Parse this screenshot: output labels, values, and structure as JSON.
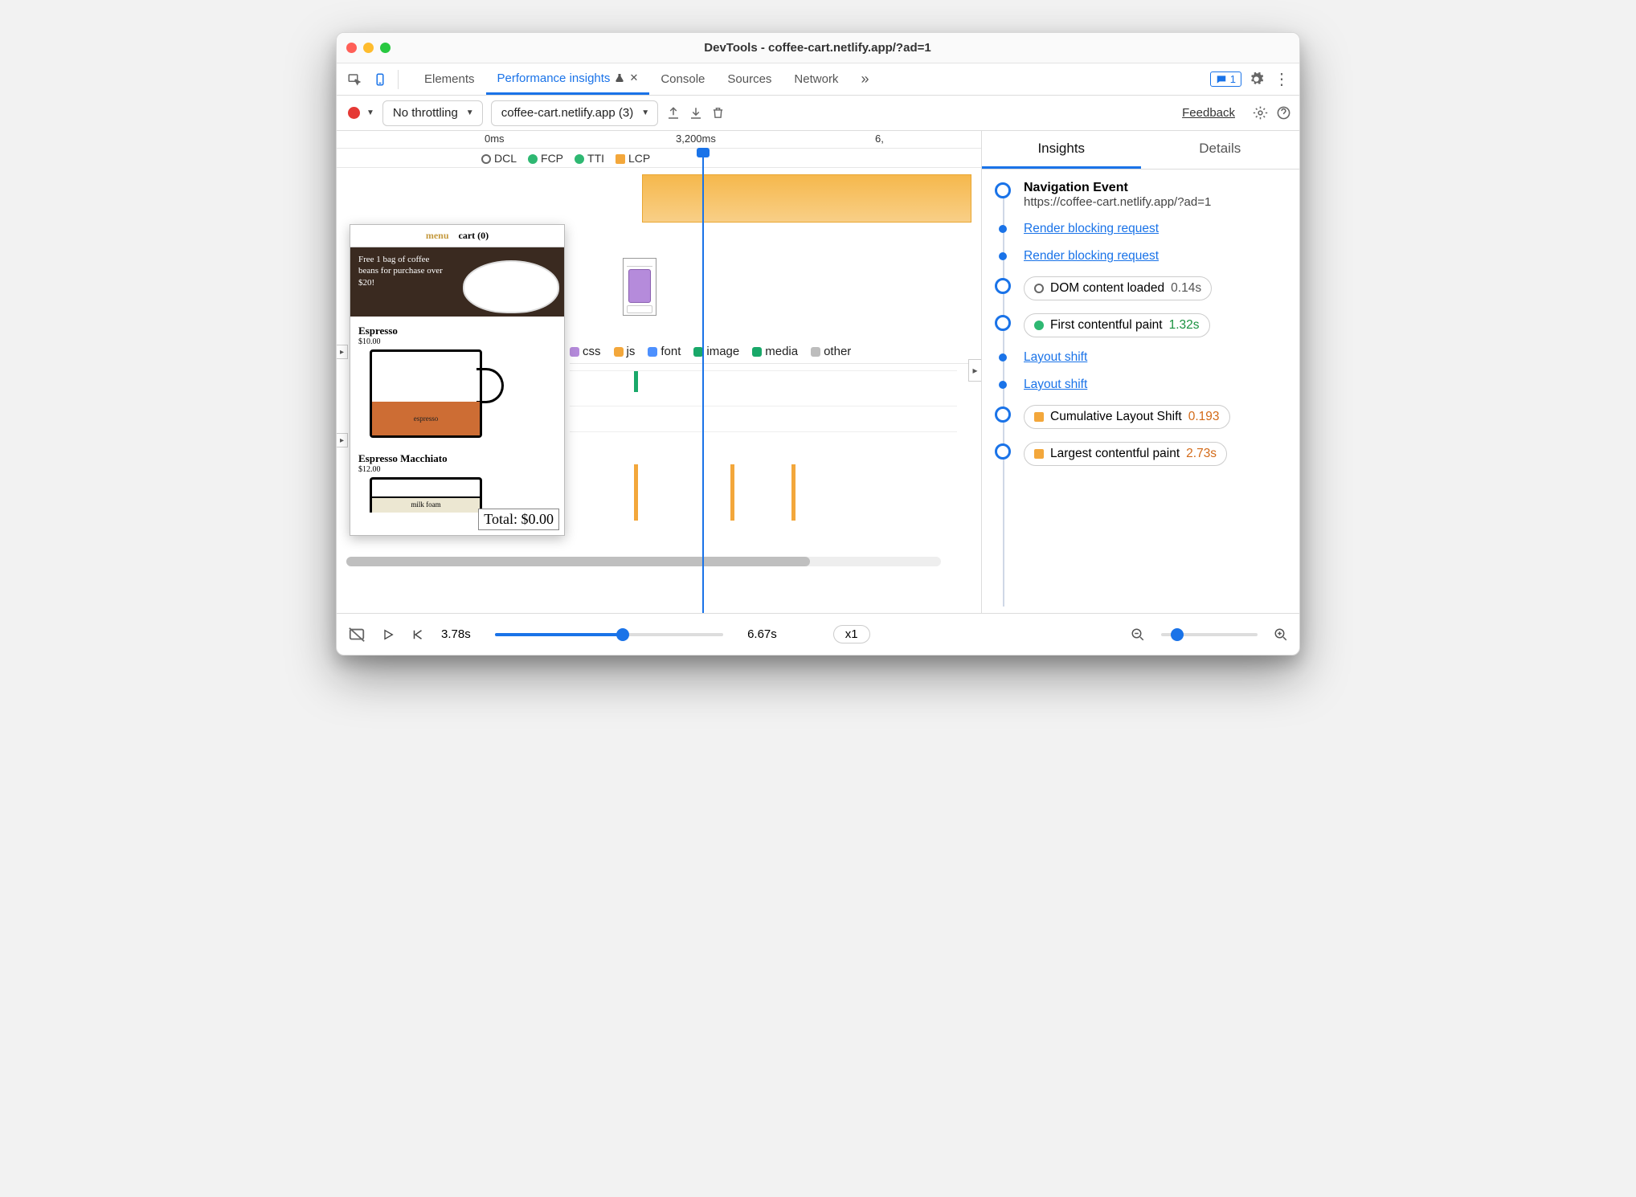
{
  "window": {
    "title": "DevTools - coffee-cart.netlify.app/?ad=1"
  },
  "tabs": {
    "elements": "Elements",
    "perf": "Performance insights",
    "console": "Console",
    "sources": "Sources",
    "network": "Network",
    "msg_count": "1"
  },
  "toolbar": {
    "throttling": "No throttling",
    "session": "coffee-cart.netlify.app (3)",
    "feedback": "Feedback"
  },
  "ruler": {
    "t0": "0ms",
    "t1": "3,200ms",
    "t2": "6,"
  },
  "markers": {
    "dcl": "DCL",
    "fcp": "FCP",
    "tti": "TTI",
    "lcp": "LCP"
  },
  "legend": {
    "css": "css",
    "js": "js",
    "font": "font",
    "image": "image",
    "media": "media",
    "other": "other"
  },
  "thumb": {
    "menu": "menu",
    "cart": "cart (0)",
    "promo": "Free 1 bag of coffee beans for purchase over $20!",
    "p1_name": "Espresso",
    "p1_price": "$10.00",
    "p1_fill": "espresso",
    "p2_name": "Espresso Macchiato",
    "p2_price": "$12.00",
    "p2_foam": "milk foam",
    "total": "Total: $0.00"
  },
  "insights": {
    "tab_insights": "Insights",
    "tab_details": "Details",
    "nav_title": "Navigation Event",
    "nav_url": "https://coffee-cart.netlify.app/?ad=1",
    "render_block": "Render blocking request",
    "dcl_label": "DOM content loaded",
    "dcl_val": "0.14s",
    "fcp_label": "First contentful paint",
    "fcp_val": "1.32s",
    "ls": "Layout shift",
    "cls_label": "Cumulative Layout Shift",
    "cls_val": "0.193",
    "lcp_label": "Largest contentful paint",
    "lcp_val": "2.73s"
  },
  "bottom": {
    "cur": "3.78s",
    "end": "6.67s",
    "zoom": "x1"
  },
  "colors": {
    "green": "#2eb872",
    "orange": "#f3a73b",
    "blue": "#4d90fe",
    "purple": "#b58bdb",
    "teal": "#19a869",
    "gray": "#bdbdbd",
    "red": "#e46a3a",
    "lcp": "#f3a73b"
  }
}
